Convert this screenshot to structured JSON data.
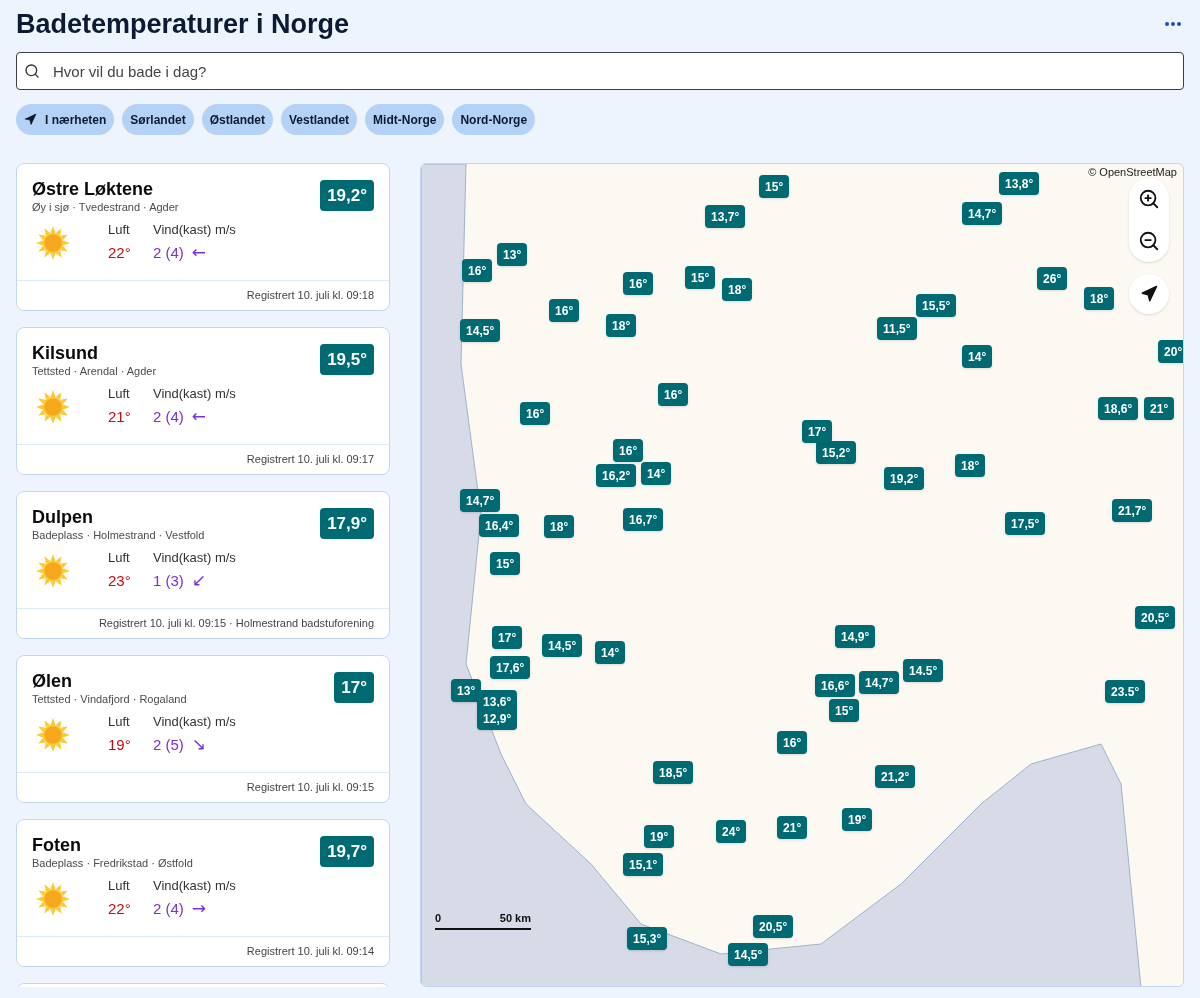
{
  "header": {
    "title": "Badetemperaturer i Norge"
  },
  "search": {
    "placeholder": "Hvor vil du bade i dag?"
  },
  "chips": [
    {
      "label": "I nærheten",
      "kind": "location"
    },
    {
      "label": "Sørlandet",
      "kind": "region"
    },
    {
      "label": "Østlandet",
      "kind": "region"
    },
    {
      "label": "Vestlandet",
      "kind": "region"
    },
    {
      "label": "Midt-Norge",
      "kind": "region"
    },
    {
      "label": "Nord-Norge",
      "kind": "region"
    }
  ],
  "cards": [
    {
      "name": "Østre Løktene",
      "meta": "Øy i sjø · Tvedestrand · Agder",
      "water": "19,2°",
      "air_label": "Luft",
      "air": "22°",
      "wind_label": "Vind(kast) m/s",
      "wind": "2 (4)",
      "wind_arrow": "←",
      "footer": "Registrert 10. juli kl. 09:18"
    },
    {
      "name": "Kilsund",
      "meta": "Tettsted · Arendal · Agder",
      "water": "19,5°",
      "air_label": "Luft",
      "air": "21°",
      "wind_label": "Vind(kast) m/s",
      "wind": "2 (4)",
      "wind_arrow": "←",
      "footer": "Registrert 10. juli kl. 09:17"
    },
    {
      "name": "Dulpen",
      "meta": "Badeplass · Holmestrand · Vestfold",
      "water": "17,9°",
      "air_label": "Luft",
      "air": "23°",
      "wind_label": "Vind(kast) m/s",
      "wind": "1 (3)",
      "wind_arrow": "↙",
      "footer": "Registrert 10. juli kl. 09:15 · Holmestrand badstuforening"
    },
    {
      "name": "Ølen",
      "meta": "Tettsted · Vindafjord · Rogaland",
      "water": "17°",
      "air_label": "Luft",
      "air": "19°",
      "wind_label": "Vind(kast) m/s",
      "wind": "2 (5)",
      "wind_arrow": "↘",
      "footer": "Registrert 10. juli kl. 09:15"
    },
    {
      "name": "Foten",
      "meta": "Badeplass · Fredrikstad · Østfold",
      "water": "19,7°",
      "air_label": "Luft",
      "air": "22°",
      "wind_label": "Vind(kast) m/s",
      "wind": "2 (4)",
      "wind_arrow": "→",
      "footer": "Registrert 10. juli kl. 09:14"
    }
  ],
  "map": {
    "attribution": "© OpenStreetMap",
    "scale": {
      "start": "0",
      "end": "50 km"
    },
    "markers": [
      {
        "label": "15°"
      },
      {
        "label": "13,7°"
      },
      {
        "label": "13°"
      },
      {
        "label": "16°"
      },
      {
        "label": "16°"
      },
      {
        "label": "15°"
      },
      {
        "label": "18°"
      },
      {
        "label": "16°"
      },
      {
        "label": "18°"
      },
      {
        "label": "14,5°"
      },
      {
        "label": "16°"
      },
      {
        "label": "16°"
      },
      {
        "label": "16°"
      },
      {
        "label": "16,2°"
      },
      {
        "label": "14°"
      },
      {
        "label": "14,7°"
      },
      {
        "label": "16,4°"
      },
      {
        "label": "16,7°"
      },
      {
        "label": "18°"
      },
      {
        "label": "15°"
      },
      {
        "label": "17°"
      },
      {
        "label": "14,5°"
      },
      {
        "label": "14°"
      },
      {
        "label": "17,6°"
      },
      {
        "label": "13°"
      },
      {
        "label": "13,6°"
      },
      {
        "label": "12,9°"
      },
      {
        "label": "18,5°"
      },
      {
        "label": "16°"
      },
      {
        "label": "19°"
      },
      {
        "label": "15,1°"
      },
      {
        "label": "24°"
      },
      {
        "label": "21°"
      },
      {
        "label": "15,3°"
      },
      {
        "label": "13,8°"
      },
      {
        "label": "14,7°"
      },
      {
        "label": "26°"
      },
      {
        "label": "18°"
      },
      {
        "label": "15,5°"
      },
      {
        "label": "11,5°"
      },
      {
        "label": "14°"
      },
      {
        "label": "20°"
      },
      {
        "label": "18,6°"
      },
      {
        "label": "21°"
      },
      {
        "label": "15,2°"
      },
      {
        "label": "18°"
      },
      {
        "label": "19,2°"
      },
      {
        "label": "17°"
      },
      {
        "label": "21,7°"
      },
      {
        "label": "17,5°"
      },
      {
        "label": "14,9°"
      },
      {
        "label": "16,6°"
      },
      {
        "label": "14,7°"
      },
      {
        "label": "15°"
      },
      {
        "label": "20,5°"
      },
      {
        "label": "19°"
      },
      {
        "label": "21,2°"
      },
      {
        "label": "23.5°"
      },
      {
        "label": "14.5°"
      },
      {
        "label": "20,5°"
      },
      {
        "label": "14,5°"
      }
    ]
  }
}
